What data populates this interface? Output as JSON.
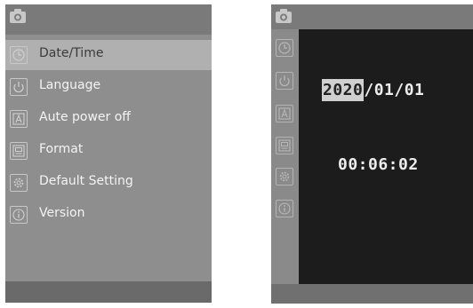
{
  "menu": {
    "items": [
      {
        "label": "Date/Time",
        "icon": "clock-icon",
        "selected": true
      },
      {
        "label": "Language",
        "icon": "power-icon",
        "selected": false
      },
      {
        "label": "Aute power off",
        "icon": "a-box-icon",
        "selected": false
      },
      {
        "label": "Format",
        "icon": "sd-card-icon",
        "selected": false
      },
      {
        "label": "Default Setting",
        "icon": "gear-icon",
        "selected": false
      },
      {
        "label": "Version",
        "icon": "info-icon",
        "selected": false
      }
    ]
  },
  "datetime": {
    "year": "2020",
    "date_rest": "/01/01",
    "time": "00:06:02"
  },
  "colors": {
    "menu_background": "#8e8e8e",
    "selected_row": "#b0b0b0",
    "panel_background": "#1c1c1c",
    "highlight": "#d0d0d0"
  }
}
